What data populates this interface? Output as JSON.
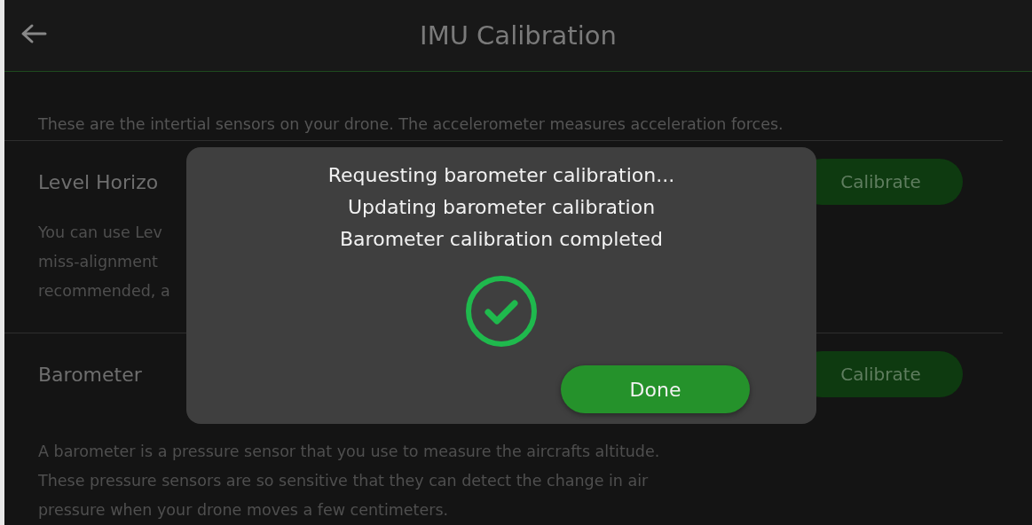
{
  "header": {
    "title": "IMU Calibration"
  },
  "intro": "These are the intertial sensors on your drone. The accelerometer measures acceleration forces.",
  "sections": [
    {
      "title": "Level Horizo",
      "button": "Calibrate",
      "description": [
        "You can use Lev",
        "miss-alignment",
        "recommended, a"
      ]
    },
    {
      "title": "Barometer",
      "button": "Calibrate",
      "description": [
        "A barometer is a pressure sensor that you use to measure the aircrafts altitude.",
        "These pressure sensors are so sensitive that they can detect the change in air",
        "pressure when your drone moves a few centimeters."
      ]
    }
  ],
  "dialog": {
    "messages": [
      "Requesting barometer calibration...",
      "Updating barometer calibration",
      "Barometer calibration completed"
    ],
    "button": "Done"
  }
}
